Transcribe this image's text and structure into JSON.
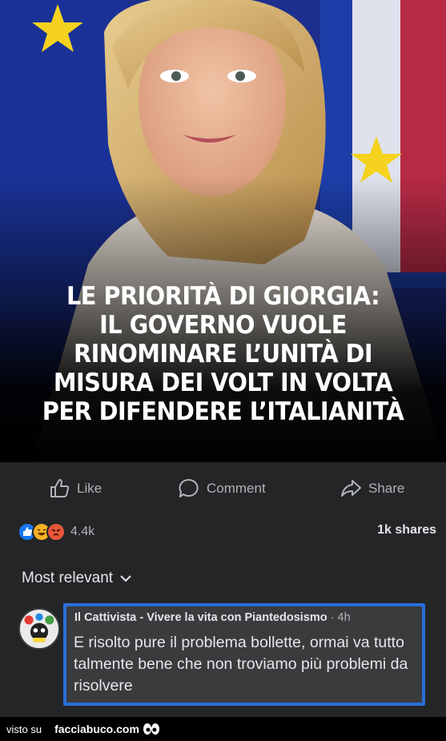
{
  "post": {
    "headline": [
      "LE PRIORITÀ DI GIORGIA:",
      "IL GOVERNO VUOLE",
      "RINOMINARE L’UNITÀ DI",
      "MISURA DEI VOLT IN VOLTA",
      "PER DIFENDERE L’ITALIANITÀ"
    ]
  },
  "actions": {
    "like": "Like",
    "comment": "Comment",
    "share": "Share"
  },
  "stats": {
    "reaction_count": "4.4k",
    "shares": "1k shares",
    "reaction_icons": [
      "like-icon",
      "haha-icon",
      "angry-icon"
    ]
  },
  "comments": {
    "sort_label": "Most relevant",
    "items": [
      {
        "author": "Il Cattivista - Vivere la vita con Piantedosismo",
        "time": "· 4h",
        "text": "E risolto pure il problema bollette, ormai va tutto talmente bene che non troviamo più problemi da risolvere"
      }
    ]
  },
  "watermark": {
    "visto": "visto su",
    "site": "facciabuco.com"
  },
  "colors": {
    "panel": "#242526",
    "comment_bg": "#3a3b3c",
    "highlight": "#2a6edb",
    "text_primary": "#e4e6eb",
    "text_secondary": "#b0b3b8"
  }
}
